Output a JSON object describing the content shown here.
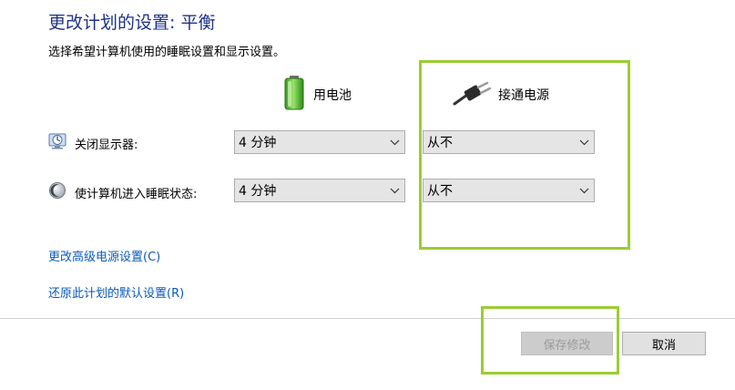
{
  "page": {
    "title": "更改计划的设置: 平衡",
    "subtitle": "选择希望计算机使用的睡眠设置和显示设置。"
  },
  "columns": {
    "battery": {
      "label": "用电池",
      "icon": "battery-icon"
    },
    "plugged_in": {
      "label": "接通电源",
      "icon": "power-plug-icon"
    }
  },
  "rows": [
    {
      "label": "关闭显示器:",
      "icon": "display-icon",
      "battery_value": "4 分钟",
      "plugged_value": "从不"
    },
    {
      "label": "使计算机进入睡眠状态:",
      "icon": "sleep-moon-icon",
      "battery_value": "4 分钟",
      "plugged_value": "从不"
    }
  ],
  "links": {
    "advanced": "更改高级电源设置(C)",
    "restore": "还原此计划的默认设置(R)"
  },
  "buttons": {
    "save": "保存修改",
    "cancel": "取消"
  },
  "colors": {
    "title": "#1e3287",
    "link": "#0b5ab8",
    "highlight": "#9acd32"
  }
}
